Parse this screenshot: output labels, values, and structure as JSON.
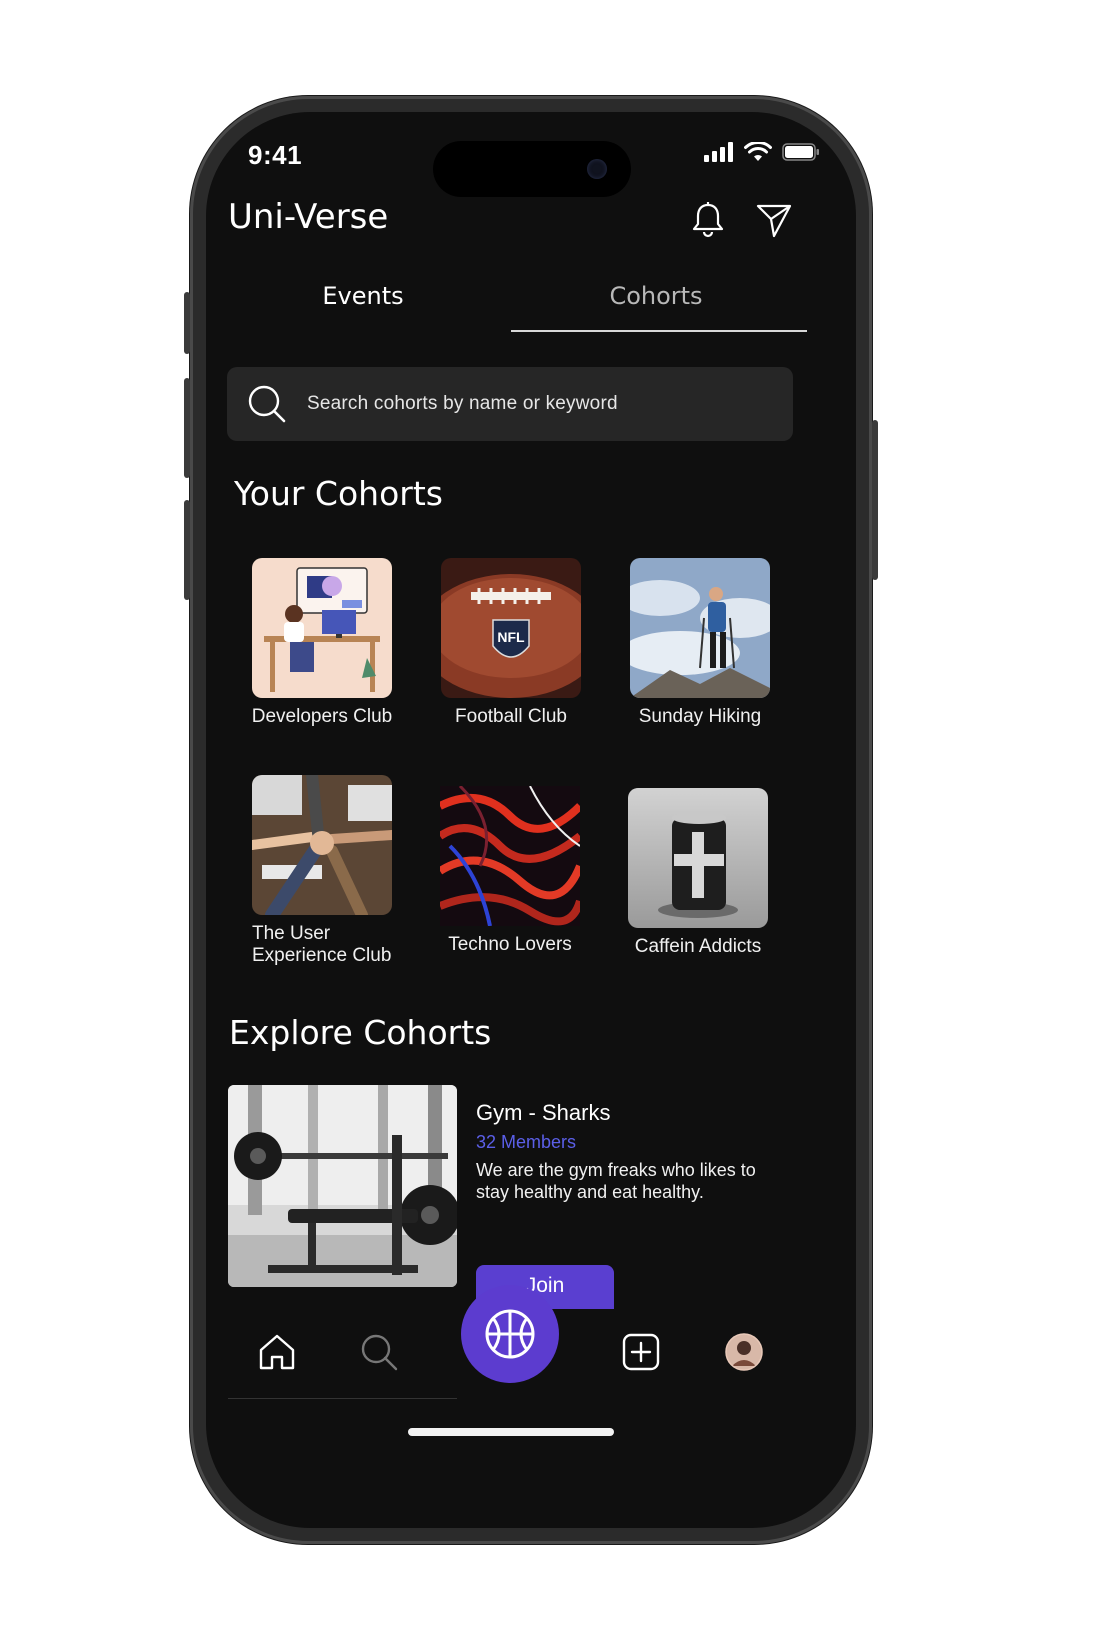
{
  "status_bar": {
    "time": "9:41"
  },
  "header": {
    "app_title": "Uni-Verse"
  },
  "tabs": [
    {
      "label": "Events"
    },
    {
      "label": "Cohorts"
    }
  ],
  "search": {
    "placeholder": "Search cohorts by name or keyword"
  },
  "your_cohorts": {
    "title": "Your Cohorts",
    "items": [
      {
        "label": "Developers Club"
      },
      {
        "label": "Football Club"
      },
      {
        "label": "Sunday Hiking"
      },
      {
        "label": "The User Experience Club"
      },
      {
        "label": "Techno Lovers"
      },
      {
        "label": "Caffein Addicts"
      }
    ]
  },
  "explore": {
    "title": "Explore Cohorts",
    "card": {
      "name": "Gym - Sharks",
      "members": "32 Members",
      "description": "We are the gym freaks who likes to stay healthy and eat healthy.",
      "join_label": "Join"
    }
  },
  "colors": {
    "accent": "#5c3ccf",
    "members_text": "#5b5fe8",
    "background": "#0f0f0f"
  }
}
